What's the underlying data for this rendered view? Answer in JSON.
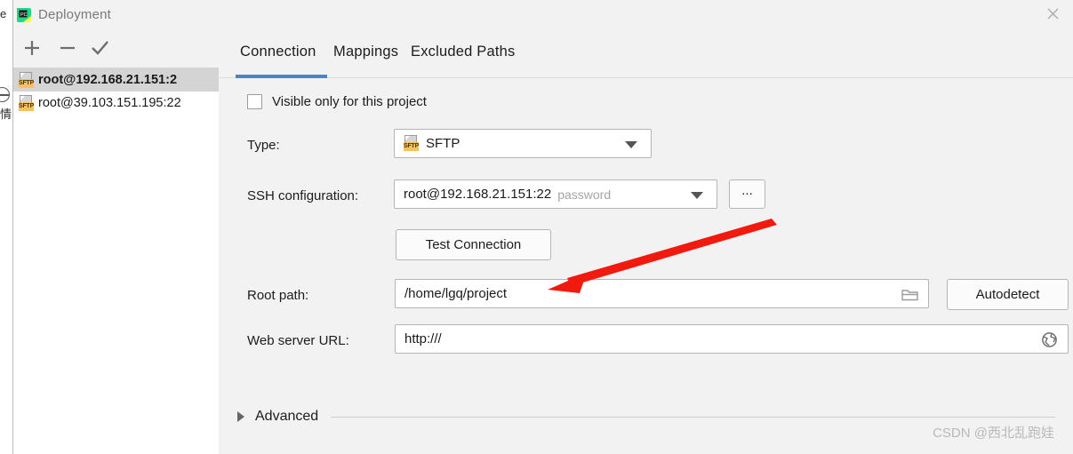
{
  "window": {
    "title": "Deployment",
    "app_icon": "pycharm-icon",
    "close_icon": "close-icon"
  },
  "toolbar": {
    "add_icon": "plus-icon",
    "remove_icon": "minus-icon",
    "confirm_icon": "checkmark-icon"
  },
  "connections": {
    "items": [
      {
        "label": "root@192.168.21.151:2",
        "icon": "sftp-icon",
        "tag": "SFTP",
        "selected": true
      },
      {
        "label": "root@39.103.151.195:22",
        "icon": "sftp-icon",
        "tag": "SFTP",
        "selected": false
      }
    ]
  },
  "tabs": {
    "items": [
      {
        "label": "Connection",
        "active": true
      },
      {
        "label": "Mappings",
        "active": false
      },
      {
        "label": "Excluded Paths",
        "active": false
      }
    ]
  },
  "form": {
    "visible_only_checkbox": {
      "label": "Visible only for this project",
      "checked": false
    },
    "type": {
      "label": "Type:",
      "value": "SFTP",
      "icon": "sftp-icon",
      "tag": "SFTP"
    },
    "ssh_configuration": {
      "label": "SSH configuration:",
      "value": "root@192.168.21.151:22",
      "hint": "password",
      "browse_button": "..."
    },
    "test_connection": {
      "label": "Test Connection"
    },
    "root_path": {
      "label": "Root path:",
      "value": "/home/lgq/project",
      "folder_icon": "folder-icon",
      "autodetect_label": "Autodetect"
    },
    "web_server_url": {
      "label": "Web server URL:",
      "value": "http:///",
      "globe_icon": "globe-icon"
    },
    "advanced": {
      "label": "Advanced",
      "expanded": false,
      "chevron_icon": "chevron-right-icon"
    }
  },
  "annotation": {
    "arrow_color": "#f11a0f",
    "points_to": "root_path"
  },
  "watermark": {
    "text": "CSDN @西北乱跑娃"
  },
  "background": {
    "left_glyph_top": "e",
    "left_glyph_bottom": "情"
  },
  "colors": {
    "accent": "#4786c8",
    "dialog_bg": "#f2f2f2",
    "panel_bg": "#ffffff",
    "selection": "#d4d4d4",
    "sftp_tag": "#f5c162"
  }
}
